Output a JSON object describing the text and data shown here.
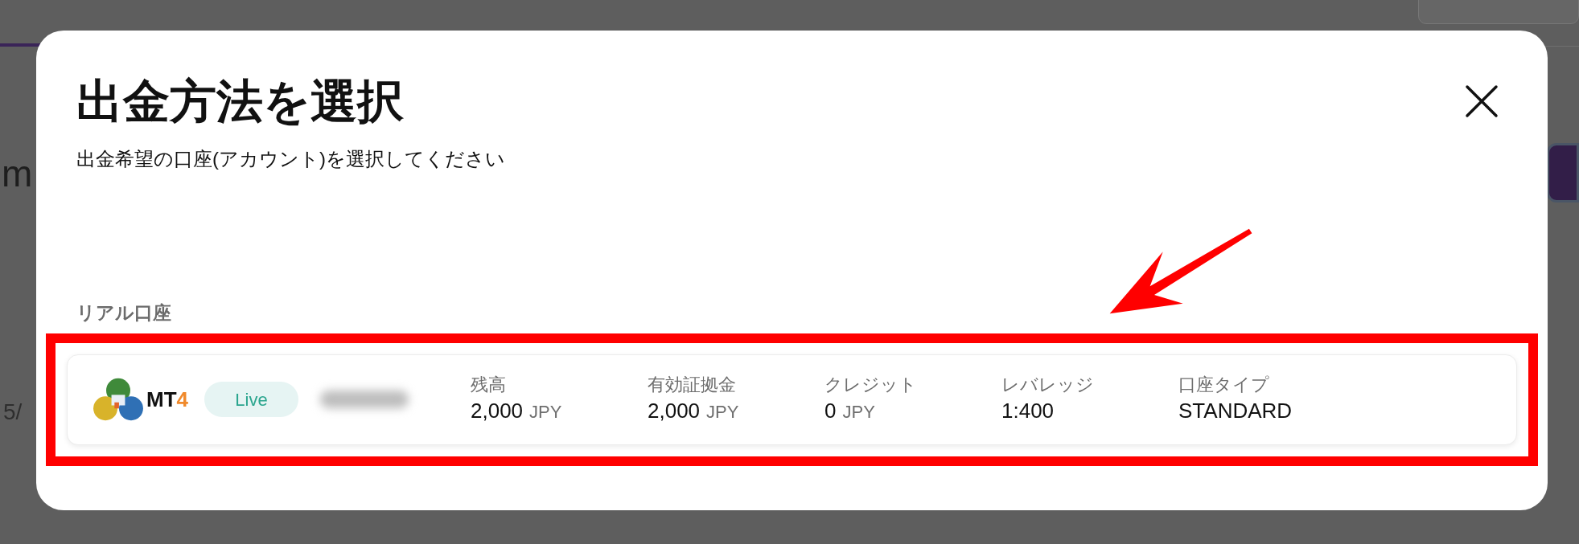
{
  "background": {
    "heading_fragment": "m",
    "date_fragment": "5/"
  },
  "dialog": {
    "title": "出金方法を選択",
    "subtitle": "出金希望の口座(アカウント)を選択してください",
    "section_label": "リアル口座",
    "account": {
      "platform": "MT",
      "platform_number": "4",
      "status": "Live",
      "highlighted": true,
      "fields": [
        {
          "label": "残高",
          "value": "2,000",
          "unit": "JPY"
        },
        {
          "label": "有効証拠金",
          "value": "2,000",
          "unit": "JPY"
        },
        {
          "label": "クレジット",
          "value": "0",
          "unit": "JPY"
        },
        {
          "label": "レバレッジ",
          "value": "1:400"
        },
        {
          "label": "口座タイプ",
          "value": "STANDARD"
        }
      ]
    }
  }
}
